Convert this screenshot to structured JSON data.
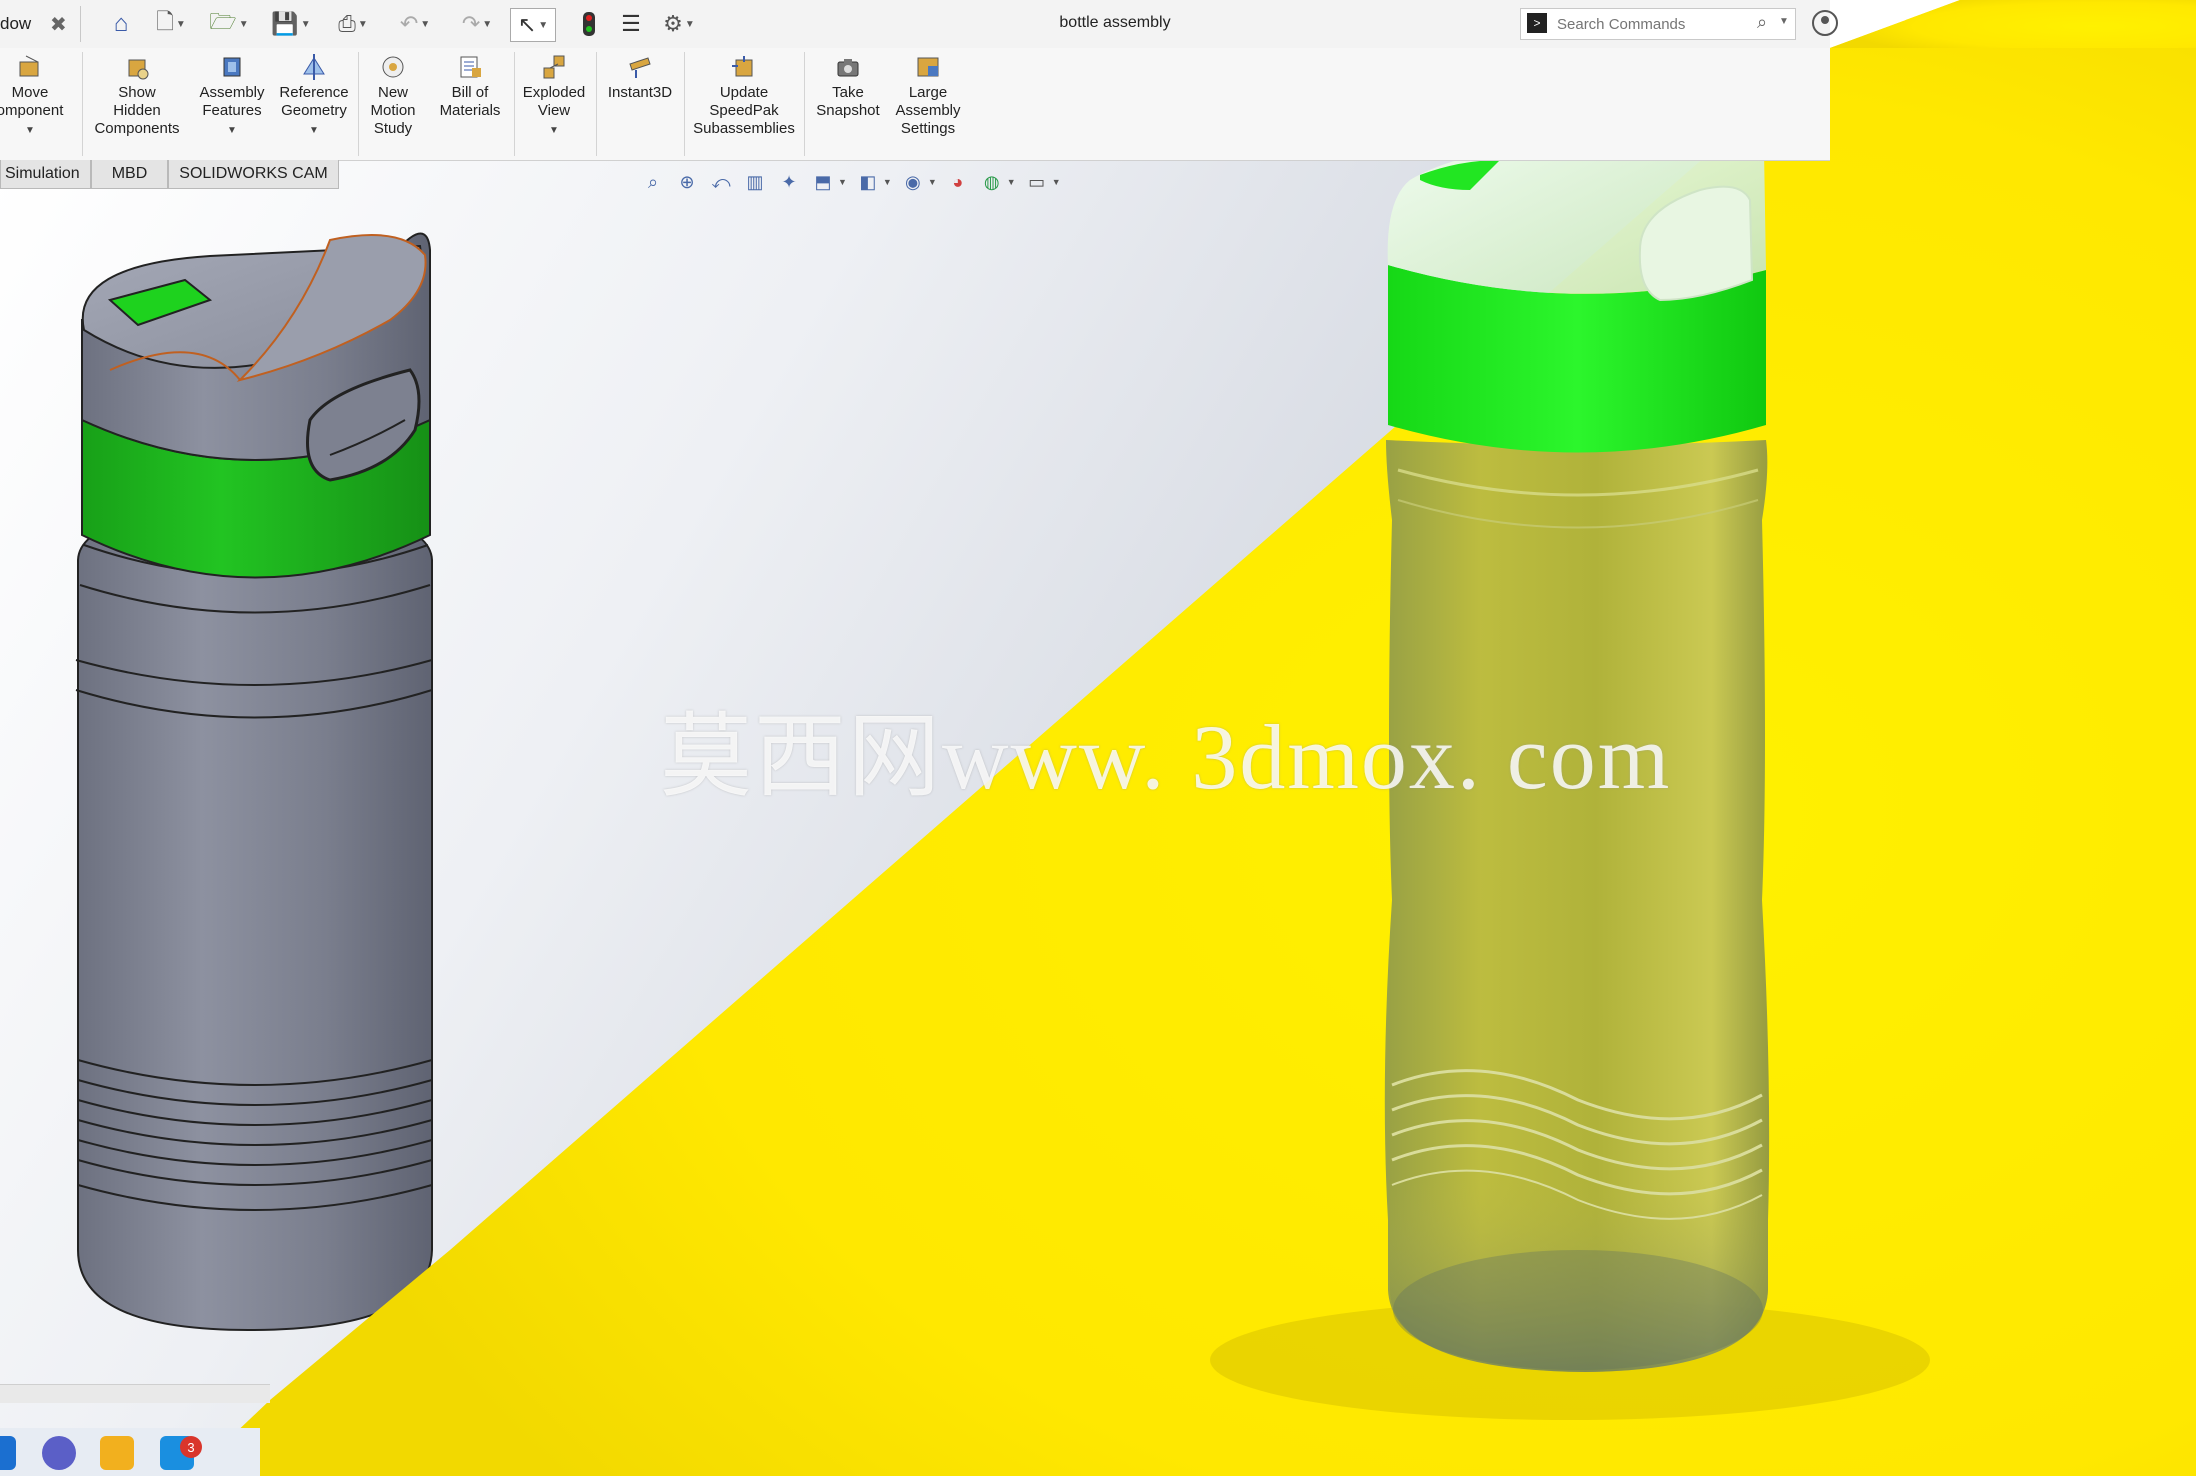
{
  "window": {
    "menu_fragment": "dow",
    "document_title": "bottle assembly"
  },
  "search": {
    "placeholder": "Search Commands"
  },
  "command_manager": {
    "items": [
      {
        "label": "Move\nomponent",
        "has_dropdown": true,
        "icon": "move-component-icon"
      },
      {
        "label": "Show\nHidden\nComponents",
        "has_dropdown": false,
        "icon": "show-hidden-icon"
      },
      {
        "label": "Assembly\nFeatures",
        "has_dropdown": true,
        "icon": "assembly-features-icon"
      },
      {
        "label": "Reference\nGeometry",
        "has_dropdown": true,
        "icon": "reference-geometry-icon"
      },
      {
        "label": "New\nMotion\nStudy",
        "has_dropdown": false,
        "icon": "motion-study-icon"
      },
      {
        "label": "Bill of\nMaterials",
        "has_dropdown": false,
        "icon": "bom-icon"
      },
      {
        "label": "Exploded\nView",
        "has_dropdown": true,
        "icon": "exploded-view-icon"
      },
      {
        "label": "Instant3D",
        "has_dropdown": false,
        "icon": "instant3d-icon"
      },
      {
        "label": "Update\nSpeedPak\nSubassemblies",
        "has_dropdown": false,
        "icon": "speedpak-icon"
      },
      {
        "label": "Take\nSnapshot",
        "has_dropdown": false,
        "icon": "camera-icon"
      },
      {
        "label": "Large\nAssembly\nSettings",
        "has_dropdown": false,
        "icon": "large-assembly-icon"
      }
    ]
  },
  "tabs": [
    "Simulation",
    "MBD",
    "SOLIDWORKS CAM"
  ],
  "watermark": "莫西网www. 3dmox. com",
  "taskbar": {
    "notification_count": "3"
  },
  "colors": {
    "accent_green": "#10e010",
    "render_background": "#ffe800",
    "cad_body": "#7c808f"
  }
}
